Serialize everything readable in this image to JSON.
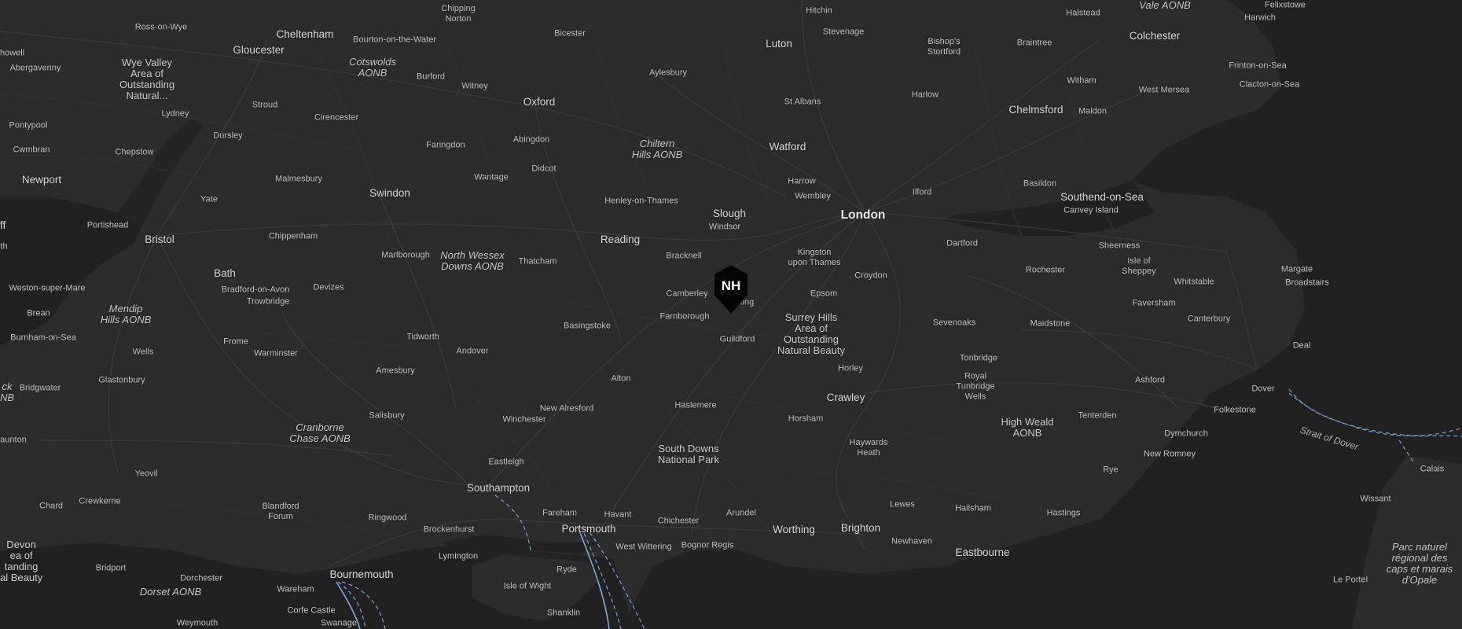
{
  "map": {
    "theme": "dark",
    "colors": {
      "land": "#2c2c2d",
      "water": "#1f1f20",
      "roads": "#3d3d3f",
      "ferry": "#7d9fd1",
      "labels": "#c9c9c9"
    },
    "marker": {
      "icon": "monogram-map-pin-icon",
      "text": "NH"
    },
    "labels": [
      {
        "id": "ross-on-wye",
        "text": "Ross-on-Wye",
        "type": "town"
      },
      {
        "id": "chipping-norton",
        "text": "Chipping\nNorton",
        "type": "town"
      },
      {
        "id": "hitchin",
        "text": "Hitchin",
        "type": "town"
      },
      {
        "id": "halstead",
        "text": "Halstead",
        "type": "town"
      },
      {
        "id": "felixstowe",
        "text": "Felixstowe",
        "type": "town"
      },
      {
        "id": "harwich",
        "text": "Harwich",
        "type": "town"
      },
      {
        "id": "vale-aonb",
        "text": "Vale AONB",
        "type": "area"
      },
      {
        "id": "howell",
        "text": "howell",
        "type": "town"
      },
      {
        "id": "abergavenny",
        "text": "Abergavenny",
        "type": "town"
      },
      {
        "id": "wye-valley",
        "text": "Wye Valley\nArea of\nOutstanding\nNatural...",
        "type": "park"
      },
      {
        "id": "gloucester",
        "text": "Gloucester",
        "type": "city"
      },
      {
        "id": "cheltenham",
        "text": "Cheltenham",
        "type": "city"
      },
      {
        "id": "bourton",
        "text": "Bourton-on-the-Water",
        "type": "town"
      },
      {
        "id": "cotswolds",
        "text": "Cotswolds\nAONB",
        "type": "area"
      },
      {
        "id": "bicester",
        "text": "Bicester",
        "type": "town"
      },
      {
        "id": "luton",
        "text": "Luton",
        "type": "city"
      },
      {
        "id": "stevenage",
        "text": "Stevenage",
        "type": "town"
      },
      {
        "id": "bishops-stortford",
        "text": "Bishop's\nStortford",
        "type": "town"
      },
      {
        "id": "braintree",
        "text": "Braintree",
        "type": "town"
      },
      {
        "id": "colchester",
        "text": "Colchester",
        "type": "city"
      },
      {
        "id": "frinton",
        "text": "Frinton-on-Sea",
        "type": "town"
      },
      {
        "id": "clacton",
        "text": "Clacton-on-Sea",
        "type": "town"
      },
      {
        "id": "burford",
        "text": "Burford",
        "type": "town"
      },
      {
        "id": "witney",
        "text": "Witney",
        "type": "town"
      },
      {
        "id": "aylesbury",
        "text": "Aylesbury",
        "type": "town"
      },
      {
        "id": "witham",
        "text": "Witham",
        "type": "town"
      },
      {
        "id": "west-mersea",
        "text": "West Mersea",
        "type": "town"
      },
      {
        "id": "stroud",
        "text": "Stroud",
        "type": "town"
      },
      {
        "id": "oxford",
        "text": "Oxford",
        "type": "city"
      },
      {
        "id": "st-albans",
        "text": "St Albans",
        "type": "town"
      },
      {
        "id": "harlow",
        "text": "Harlow",
        "type": "town"
      },
      {
        "id": "chelmsford",
        "text": "Chelmsford",
        "type": "city"
      },
      {
        "id": "maldon",
        "text": "Maldon",
        "type": "town"
      },
      {
        "id": "lydney",
        "text": "Lydney",
        "type": "town"
      },
      {
        "id": "cirencester",
        "text": "Cirencester",
        "type": "town"
      },
      {
        "id": "pontypool",
        "text": "Pontypool",
        "type": "town"
      },
      {
        "id": "dursley",
        "text": "Dursley",
        "type": "town"
      },
      {
        "id": "abingdon",
        "text": "Abingdon",
        "type": "town"
      },
      {
        "id": "faringdon",
        "text": "Faringdon",
        "type": "town"
      },
      {
        "id": "chiltern",
        "text": "Chiltern\nHills AONB",
        "type": "area"
      },
      {
        "id": "watford",
        "text": "Watford",
        "type": "city"
      },
      {
        "id": "cwmbran",
        "text": "Cwmbran",
        "type": "town"
      },
      {
        "id": "chepstow",
        "text": "Chepstow",
        "type": "town"
      },
      {
        "id": "didcot",
        "text": "Didcot",
        "type": "town"
      },
      {
        "id": "newport",
        "text": "Newport",
        "type": "city"
      },
      {
        "id": "malmesbury",
        "text": "Malmesbury",
        "type": "town"
      },
      {
        "id": "wantage",
        "text": "Wantage",
        "type": "town"
      },
      {
        "id": "harrow",
        "text": "Harrow",
        "type": "town"
      },
      {
        "id": "basildon",
        "text": "Basildon",
        "type": "town"
      },
      {
        "id": "ilford",
        "text": "Ilford",
        "type": "town"
      },
      {
        "id": "swindon",
        "text": "Swindon",
        "type": "city"
      },
      {
        "id": "wembley",
        "text": "Wembley",
        "type": "town"
      },
      {
        "id": "southend",
        "text": "Southend-on-Sea",
        "type": "city"
      },
      {
        "id": "yate",
        "text": "Yate",
        "type": "town"
      },
      {
        "id": "henley",
        "text": "Henley-on-Thames",
        "type": "town"
      },
      {
        "id": "canvey",
        "text": "Canvey Island",
        "type": "town"
      },
      {
        "id": "slough",
        "text": "Slough",
        "type": "city"
      },
      {
        "id": "london",
        "text": "London",
        "type": "major"
      },
      {
        "id": "ff",
        "text": "ff",
        "type": "city"
      },
      {
        "id": "portishead",
        "text": "Portishead",
        "type": "town"
      },
      {
        "id": "windsor",
        "text": "Windsor",
        "type": "town"
      },
      {
        "id": "th",
        "text": "th",
        "type": "town"
      },
      {
        "id": "bristol",
        "text": "Bristol",
        "type": "city"
      },
      {
        "id": "chippenham",
        "text": "Chippenham",
        "type": "town"
      },
      {
        "id": "reading",
        "text": "Reading",
        "type": "city"
      },
      {
        "id": "dartford",
        "text": "Dartford",
        "type": "town"
      },
      {
        "id": "sheerness",
        "text": "Sheerness",
        "type": "town"
      },
      {
        "id": "marlborough",
        "text": "Marlborough",
        "type": "town"
      },
      {
        "id": "north-wessex",
        "text": "North Wessex\nDowns AONB",
        "type": "area"
      },
      {
        "id": "kingston",
        "text": "Kingston\nupon Thames",
        "type": "town"
      },
      {
        "id": "bracknell",
        "text": "Bracknell",
        "type": "town"
      },
      {
        "id": "thatcham",
        "text": "Thatcham",
        "type": "town"
      },
      {
        "id": "isle-of-sheppey",
        "text": "Isle of\nSheppey",
        "type": "town"
      },
      {
        "id": "bath",
        "text": "Bath",
        "type": "city"
      },
      {
        "id": "margate",
        "text": "Margate",
        "type": "town"
      },
      {
        "id": "rochester",
        "text": "Rochester",
        "type": "town"
      },
      {
        "id": "croydon",
        "text": "Croydon",
        "type": "town"
      },
      {
        "id": "whitstable",
        "text": "Whitstable",
        "type": "town"
      },
      {
        "id": "broadstairs",
        "text": "Broadstairs",
        "type": "town"
      },
      {
        "id": "weston",
        "text": "Weston-super-Mare",
        "type": "town"
      },
      {
        "id": "bradford-on-avon",
        "text": "Bradford-on-Avon",
        "type": "town"
      },
      {
        "id": "devizes",
        "text": "Devizes",
        "type": "town"
      },
      {
        "id": "trowbridge",
        "text": "Trowbridge",
        "type": "town"
      },
      {
        "id": "camberley",
        "text": "Camberley",
        "type": "town"
      },
      {
        "id": "woking",
        "text": "Woking",
        "type": "town"
      },
      {
        "id": "epsom",
        "text": "Epsom",
        "type": "town"
      },
      {
        "id": "faversham",
        "text": "Faversham",
        "type": "town"
      },
      {
        "id": "mendip",
        "text": "Mendip\nHills AONB",
        "type": "area"
      },
      {
        "id": "brean",
        "text": "Brean",
        "type": "town"
      },
      {
        "id": "farnborough",
        "text": "Farnborough",
        "type": "town"
      },
      {
        "id": "surrey-hills",
        "text": "Surrey Hills\nArea of\nOutstanding\nNatural Beauty",
        "type": "park"
      },
      {
        "id": "sevenoaks",
        "text": "Sevenoaks",
        "type": "town"
      },
      {
        "id": "basingstoke",
        "text": "Basingstoke",
        "type": "town"
      },
      {
        "id": "maidstone",
        "text": "Maidstone",
        "type": "town"
      },
      {
        "id": "canterbury",
        "text": "Canterbury",
        "type": "town"
      },
      {
        "id": "burnham",
        "text": "Burnham-on-Sea",
        "type": "town"
      },
      {
        "id": "tidworth",
        "text": "Tidworth",
        "type": "town"
      },
      {
        "id": "guildford",
        "text": "Guildford",
        "type": "town"
      },
      {
        "id": "frome",
        "text": "Frome",
        "type": "town"
      },
      {
        "id": "deal",
        "text": "Deal",
        "type": "town"
      },
      {
        "id": "wells",
        "text": "Wells",
        "type": "town"
      },
      {
        "id": "warminster",
        "text": "Warminster",
        "type": "town"
      },
      {
        "id": "andover",
        "text": "Andover",
        "type": "town"
      },
      {
        "id": "tonbridge",
        "text": "Tonbridge",
        "type": "town"
      },
      {
        "id": "horley",
        "text": "Horley",
        "type": "town"
      },
      {
        "id": "amesbury",
        "text": "Amesbury",
        "type": "town"
      },
      {
        "id": "royal-tunbridge",
        "text": "Royal\nTunbridge\nWells",
        "type": "town"
      },
      {
        "id": "glastonbury",
        "text": "Glastonbury",
        "type": "town"
      },
      {
        "id": "alton",
        "text": "Alton",
        "type": "town"
      },
      {
        "id": "ashford",
        "text": "Ashford",
        "type": "town"
      },
      {
        "id": "ck",
        "text": "ck\nNB",
        "type": "area"
      },
      {
        "id": "bridgwater",
        "text": "Bridgwater",
        "type": "town"
      },
      {
        "id": "dover",
        "text": "Dover",
        "type": "town"
      },
      {
        "id": "crawley",
        "text": "Crawley",
        "type": "city"
      },
      {
        "id": "haslemere",
        "text": "Haslemere",
        "type": "town"
      },
      {
        "id": "new-alresford",
        "text": "New Alresford",
        "type": "town"
      },
      {
        "id": "folkestone",
        "text": "Folkestone",
        "type": "town"
      },
      {
        "id": "salisbury",
        "text": "Salisbury",
        "type": "town"
      },
      {
        "id": "tenterden",
        "text": "Tenterden",
        "type": "town"
      },
      {
        "id": "horsham",
        "text": "Horsham",
        "type": "town"
      },
      {
        "id": "winchester",
        "text": "Winchester",
        "type": "town"
      },
      {
        "id": "high-weald",
        "text": "High Weald\nAONB",
        "type": "park"
      },
      {
        "id": "cranborne",
        "text": "Cranborne\nChase AONB",
        "type": "area"
      },
      {
        "id": "strait-of-dover",
        "text": "Strait of Dover",
        "type": "water"
      },
      {
        "id": "taunton",
        "text": "aunton",
        "type": "town"
      },
      {
        "id": "dymchurch",
        "text": "Dymchurch",
        "type": "town"
      },
      {
        "id": "haywards-heath",
        "text": "Haywards\nHeath",
        "type": "town"
      },
      {
        "id": "south-downs",
        "text": "South Downs\nNational Park",
        "type": "park"
      },
      {
        "id": "new-romney",
        "text": "New Romney",
        "type": "town"
      },
      {
        "id": "eastleigh",
        "text": "Eastleigh",
        "type": "town"
      },
      {
        "id": "calais",
        "text": "Calais",
        "type": "town"
      },
      {
        "id": "yeovil",
        "text": "Yeovil",
        "type": "town"
      },
      {
        "id": "rye",
        "text": "Rye",
        "type": "town"
      },
      {
        "id": "southampton",
        "text": "Southampton",
        "type": "city"
      },
      {
        "id": "crewkerne",
        "text": "Crewkerne",
        "type": "town"
      },
      {
        "id": "wissant",
        "text": "Wissant",
        "type": "town"
      },
      {
        "id": "chard",
        "text": "Chard",
        "type": "town"
      },
      {
        "id": "lewes",
        "text": "Lewes",
        "type": "town"
      },
      {
        "id": "blandford",
        "text": "Blandford\nForum",
        "type": "town"
      },
      {
        "id": "hailsham",
        "text": "Hailsham",
        "type": "town"
      },
      {
        "id": "fareham",
        "text": "Fareham",
        "type": "town"
      },
      {
        "id": "havant",
        "text": "Havant",
        "type": "town"
      },
      {
        "id": "arundel",
        "text": "Arundel",
        "type": "town"
      },
      {
        "id": "hastings",
        "text": "Hastings",
        "type": "town"
      },
      {
        "id": "ringwood",
        "text": "Ringwood",
        "type": "town"
      },
      {
        "id": "chichester",
        "text": "Chichester",
        "type": "town"
      },
      {
        "id": "brockenhurst",
        "text": "Brockenhurst",
        "type": "town"
      },
      {
        "id": "portsmouth",
        "text": "Portsmouth",
        "type": "city"
      },
      {
        "id": "worthing",
        "text": "Worthing",
        "type": "city"
      },
      {
        "id": "brighton",
        "text": "Brighton",
        "type": "city"
      },
      {
        "id": "devon",
        "text": "Devon\nea of\ntanding\nal Beauty",
        "type": "park"
      },
      {
        "id": "newhaven",
        "text": "Newhaven",
        "type": "town"
      },
      {
        "id": "west-wittering",
        "text": "West Wittering",
        "type": "town"
      },
      {
        "id": "bognor",
        "text": "Bognor Regis",
        "type": "town"
      },
      {
        "id": "parc-naturel",
        "text": "Parc naturel\nrégional des\ncaps et marais\nd'Opale",
        "type": "area"
      },
      {
        "id": "eastbourne",
        "text": "Eastbourne",
        "type": "city"
      },
      {
        "id": "lymington",
        "text": "Lymington",
        "type": "town"
      },
      {
        "id": "bridport",
        "text": "Bridport",
        "type": "town"
      },
      {
        "id": "ryde",
        "text": "Ryde",
        "type": "town"
      },
      {
        "id": "bournemouth",
        "text": "Bournemouth",
        "type": "city"
      },
      {
        "id": "dorchester",
        "text": "Dorchester",
        "type": "town"
      },
      {
        "id": "le-portel",
        "text": "Le Portel",
        "type": "town"
      },
      {
        "id": "dorset",
        "text": "Dorset AONB",
        "type": "area"
      },
      {
        "id": "wareham",
        "text": "Wareham",
        "type": "town"
      },
      {
        "id": "isle-of-wight",
        "text": "Isle of Wight",
        "type": "town"
      },
      {
        "id": "corfe",
        "text": "Corfe Castle",
        "type": "town"
      },
      {
        "id": "shanklin",
        "text": "Shanklin",
        "type": "town"
      },
      {
        "id": "weymouth",
        "text": "Weymouth",
        "type": "town"
      },
      {
        "id": "swanage",
        "text": "Swanage",
        "type": "town"
      }
    ]
  }
}
